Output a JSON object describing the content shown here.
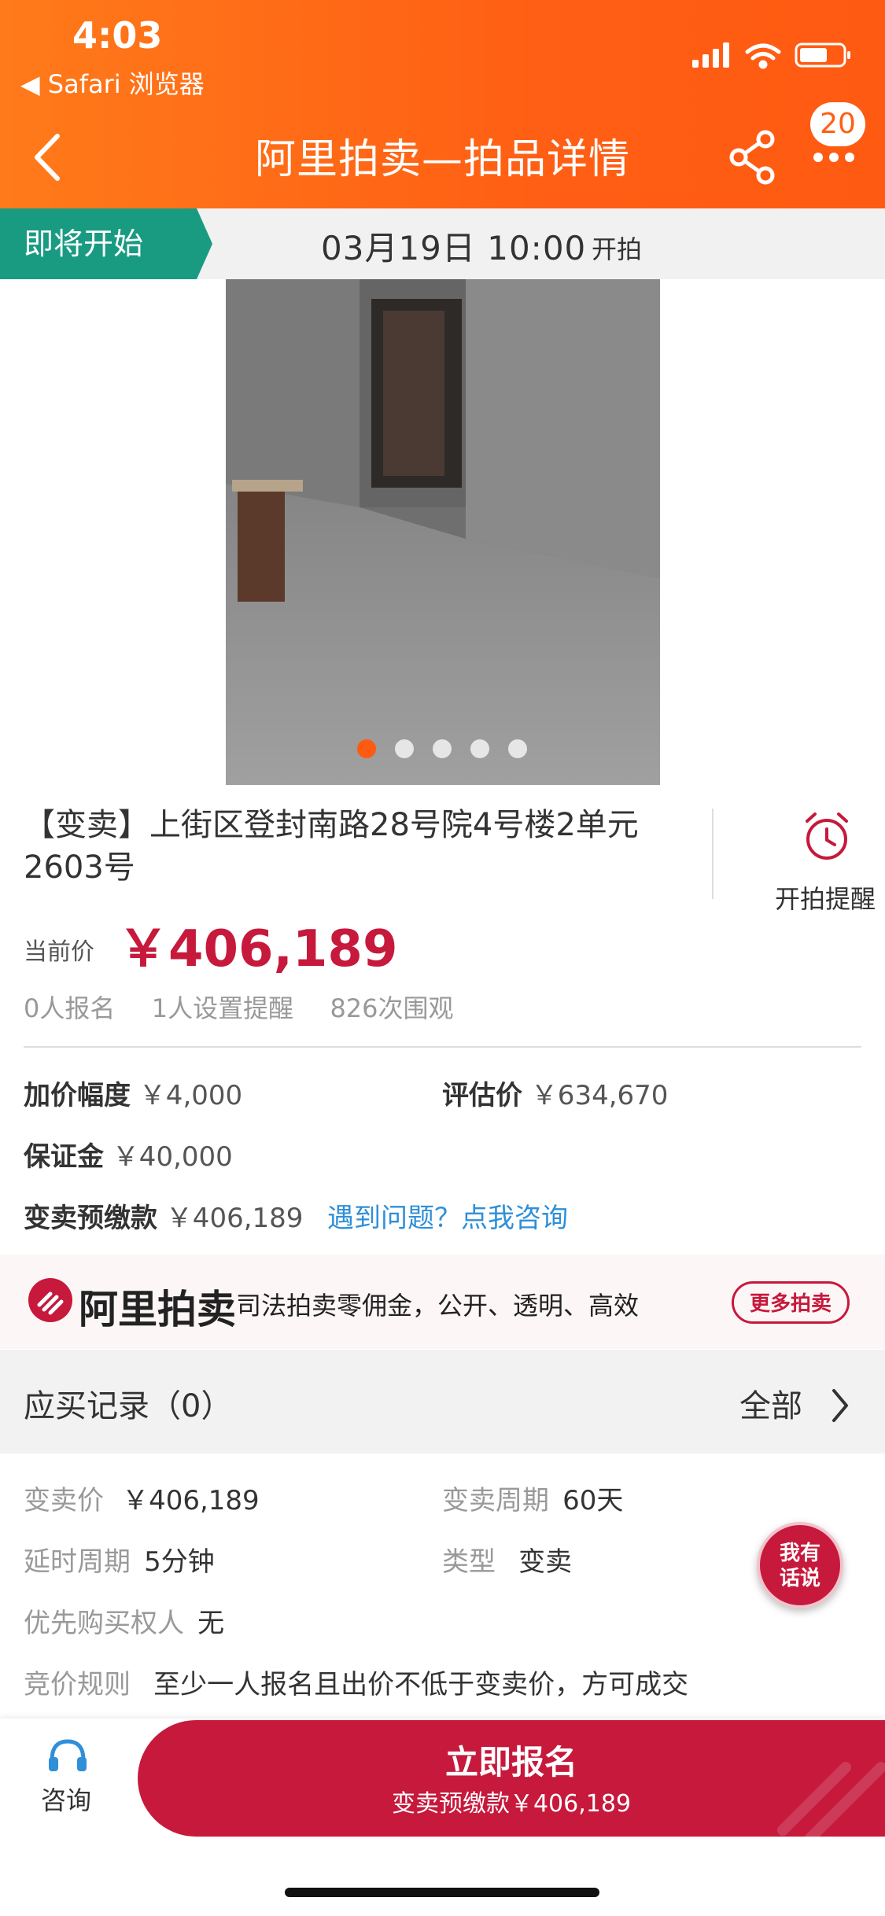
{
  "status_bar": {
    "time": "4:03",
    "back_app": "Safari 浏览器"
  },
  "nav": {
    "title": "阿里拍卖—拍品详情",
    "badge_count": "20"
  },
  "auction_status": {
    "tag": "即将开始",
    "start_time": "03月19日  10:00",
    "start_suffix": "开拍"
  },
  "gallery": {
    "image_count": 5,
    "active_index": 0
  },
  "item": {
    "title": "【变卖】上街区登封南路28号院4号楼2单元2603号",
    "remind_label": "开拍提醒",
    "price_label": "当前价",
    "price": "￥406,189",
    "stats": [
      "0人报名",
      "1人设置提醒",
      "826次围观"
    ]
  },
  "details": {
    "increment_label": "加价幅度",
    "increment_value": "￥4,000",
    "appraisal_label": "评估价",
    "appraisal_value": "￥634,670",
    "deposit_label": "保证金",
    "deposit_value": "￥40,000",
    "prepay_label": "变卖预缴款",
    "prepay_value": "￥406,189",
    "help_link": "遇到问题？点我咨询"
  },
  "banner": {
    "brand": "阿里拍卖",
    "slogan": "司法拍卖零佣金，公开、透明、高效",
    "more_button": "更多拍卖"
  },
  "records": {
    "title": "应买记录（0）",
    "all_label": "全部"
  },
  "info": {
    "sale_price_label": "变卖价",
    "sale_price_value": "￥406,189",
    "sale_period_label": "变卖周期",
    "sale_period_value": "60天",
    "delay_label": "延时周期",
    "delay_value": "5分钟",
    "type_label": "类型",
    "type_value": "变卖",
    "priority_label": "优先购买权人",
    "priority_value": "无",
    "rule_label": "竞价规则",
    "rule_value": "至少一人报名且出价不低于变卖价，方可成交"
  },
  "fab": {
    "line1": "我有",
    "line2": "话说"
  },
  "bottom": {
    "consult_label": "咨询",
    "cta_main": "立即报名",
    "cta_sub": "变卖预缴款￥406,189"
  },
  "colors": {
    "header": "#ff6a17",
    "accent": "#c6193c",
    "tag": "#199b82",
    "link": "#2f8fd8"
  }
}
